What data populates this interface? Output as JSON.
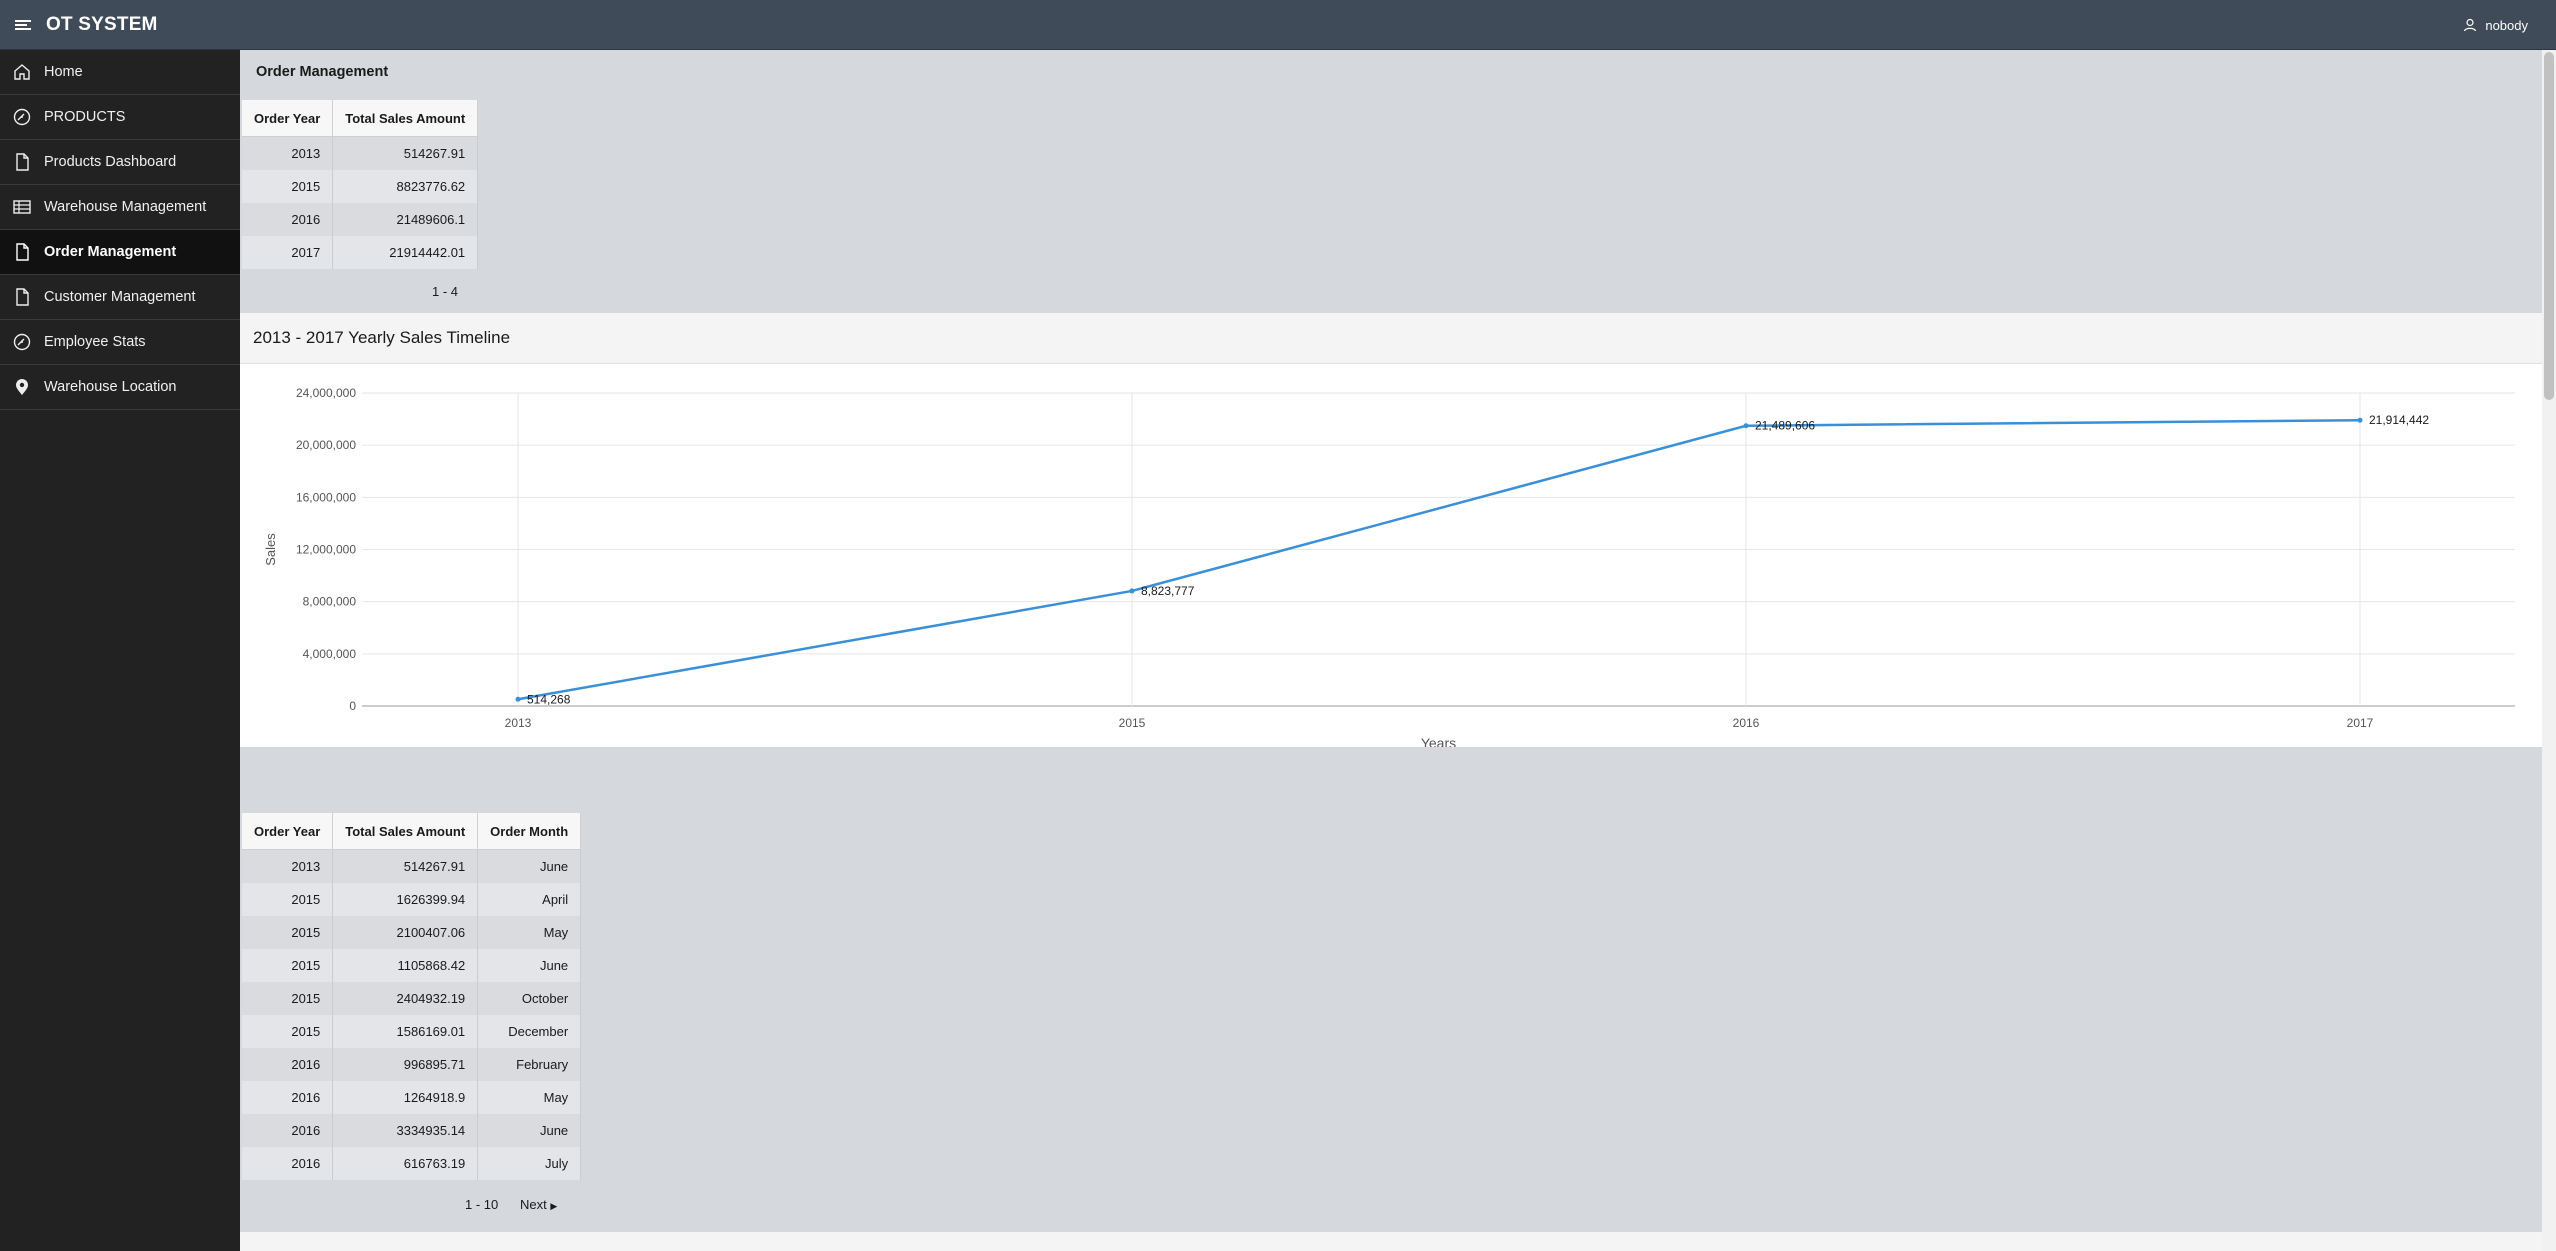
{
  "header": {
    "title": "OT SYSTEM",
    "user": "nobody"
  },
  "sidebar": {
    "items": [
      {
        "label": "Home",
        "icon": "home-icon"
      },
      {
        "label": "PRODUCTS",
        "icon": "gauge-icon"
      },
      {
        "label": "Products Dashboard",
        "icon": "document-icon"
      },
      {
        "label": "Warehouse Management",
        "icon": "table-icon"
      },
      {
        "label": "Order Management",
        "icon": "document-icon",
        "active": true
      },
      {
        "label": "Customer Management",
        "icon": "document-icon"
      },
      {
        "label": "Employee Stats",
        "icon": "gauge-icon"
      },
      {
        "label": "Warehouse Location",
        "icon": "map-pin-icon"
      }
    ]
  },
  "yearly_report": {
    "title": "Order Management",
    "columns": [
      "Order Year",
      "Total Sales Amount"
    ],
    "rows": [
      [
        "2013",
        "514267.91"
      ],
      [
        "2015",
        "8823776.62"
      ],
      [
        "2016",
        "21489606.1"
      ],
      [
        "2017",
        "21914442.01"
      ]
    ],
    "pagination": "1 - 4"
  },
  "chart": {
    "title": "2013 - 2017 Yearly Sales Timeline"
  },
  "chart_data": {
    "type": "line",
    "title": "2013 - 2017 Yearly Sales Timeline",
    "xlabel": "Years",
    "ylabel": "Sales",
    "categories": [
      "2013",
      "2015",
      "2016",
      "2017"
    ],
    "values": [
      514268,
      8823777,
      21489606,
      21914442
    ],
    "data_labels": [
      "514,268",
      "8,823,777",
      "21,489,606",
      "21,914,442"
    ],
    "y_ticks": [
      "0",
      "4,000,000",
      "8,000,000",
      "12,000,000",
      "16,000,000",
      "20,000,000",
      "24,000,000"
    ],
    "ylim": [
      0,
      24000000
    ],
    "grid": true,
    "line_color": "#3a8fd9"
  },
  "monthly_report": {
    "columns": [
      "Order Year",
      "Total Sales Amount",
      "Order Month"
    ],
    "rows": [
      [
        "2013",
        "514267.91",
        "June"
      ],
      [
        "2015",
        "1626399.94",
        "April"
      ],
      [
        "2015",
        "2100407.06",
        "May"
      ],
      [
        "2015",
        "1105868.42",
        "June"
      ],
      [
        "2015",
        "2404932.19",
        "October"
      ],
      [
        "2015",
        "1586169.01",
        "December"
      ],
      [
        "2016",
        "996895.71",
        "February"
      ],
      [
        "2016",
        "1264918.9",
        "May"
      ],
      [
        "2016",
        "3334935.14",
        "June"
      ],
      [
        "2016",
        "616763.19",
        "July"
      ]
    ],
    "pagination": "1 - 10",
    "next_label": "Next"
  }
}
